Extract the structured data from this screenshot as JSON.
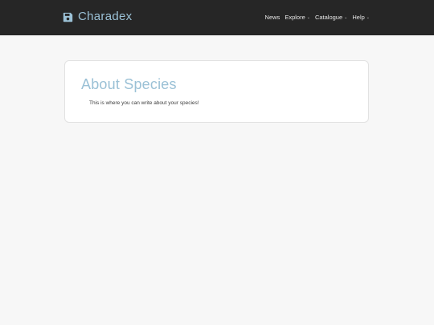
{
  "header": {
    "brand": "Charadex",
    "brand_icon": "floppy-disk-icon",
    "nav": [
      {
        "label": "News",
        "dropdown": false
      },
      {
        "label": "Explore",
        "dropdown": true
      },
      {
        "label": "Catalogue",
        "dropdown": true
      },
      {
        "label": "Help",
        "dropdown": true
      }
    ]
  },
  "main": {
    "title": "About Species",
    "body": "This is where you can write about your species!"
  },
  "colors": {
    "navbar_bg": "#262626",
    "accent": "#9bc1d6",
    "page_bg": "#f7f7f7"
  }
}
